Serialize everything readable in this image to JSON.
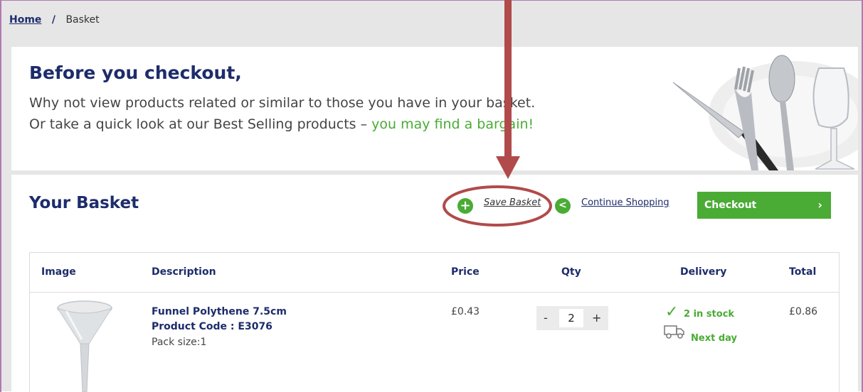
{
  "breadcrumb": {
    "home": "Home",
    "separator": "/",
    "current": "Basket"
  },
  "promo": {
    "title": "Before you checkout,",
    "line1": "Why not view products related or similar to those you have in your basket.",
    "line2_prefix": "Or take a quick look at our Best Selling products – ",
    "line2_highlight": "you may find a bargain!",
    "image_icon": "cutlery-icon"
  },
  "basket": {
    "title": "Your Basket",
    "save_label": "Save Basket",
    "save_icon": "plus-circle-icon",
    "continue_label": "Continue Shopping",
    "continue_icon": "chevron-left-circle-icon",
    "checkout_label": "Checkout",
    "checkout_chevron": "›"
  },
  "table": {
    "headers": [
      "Image",
      "Description",
      "Price",
      "Qty",
      "Delivery",
      "Total"
    ],
    "rows": [
      {
        "name": "Funnel Polythene 7.5cm",
        "code": "Product Code : E3076",
        "pack": "Pack size:1",
        "price": "£0.43",
        "qty": "2",
        "stock": "2 in stock",
        "delivery": "Next day",
        "total": "£0.86",
        "image_icon": "funnel-icon"
      }
    ]
  },
  "qty_controls": {
    "minus": "-",
    "plus": "+"
  },
  "colors": {
    "brand_navy": "#1d2c6b",
    "accent_green": "#4aab35",
    "annotation_red": "#b14a4a"
  }
}
